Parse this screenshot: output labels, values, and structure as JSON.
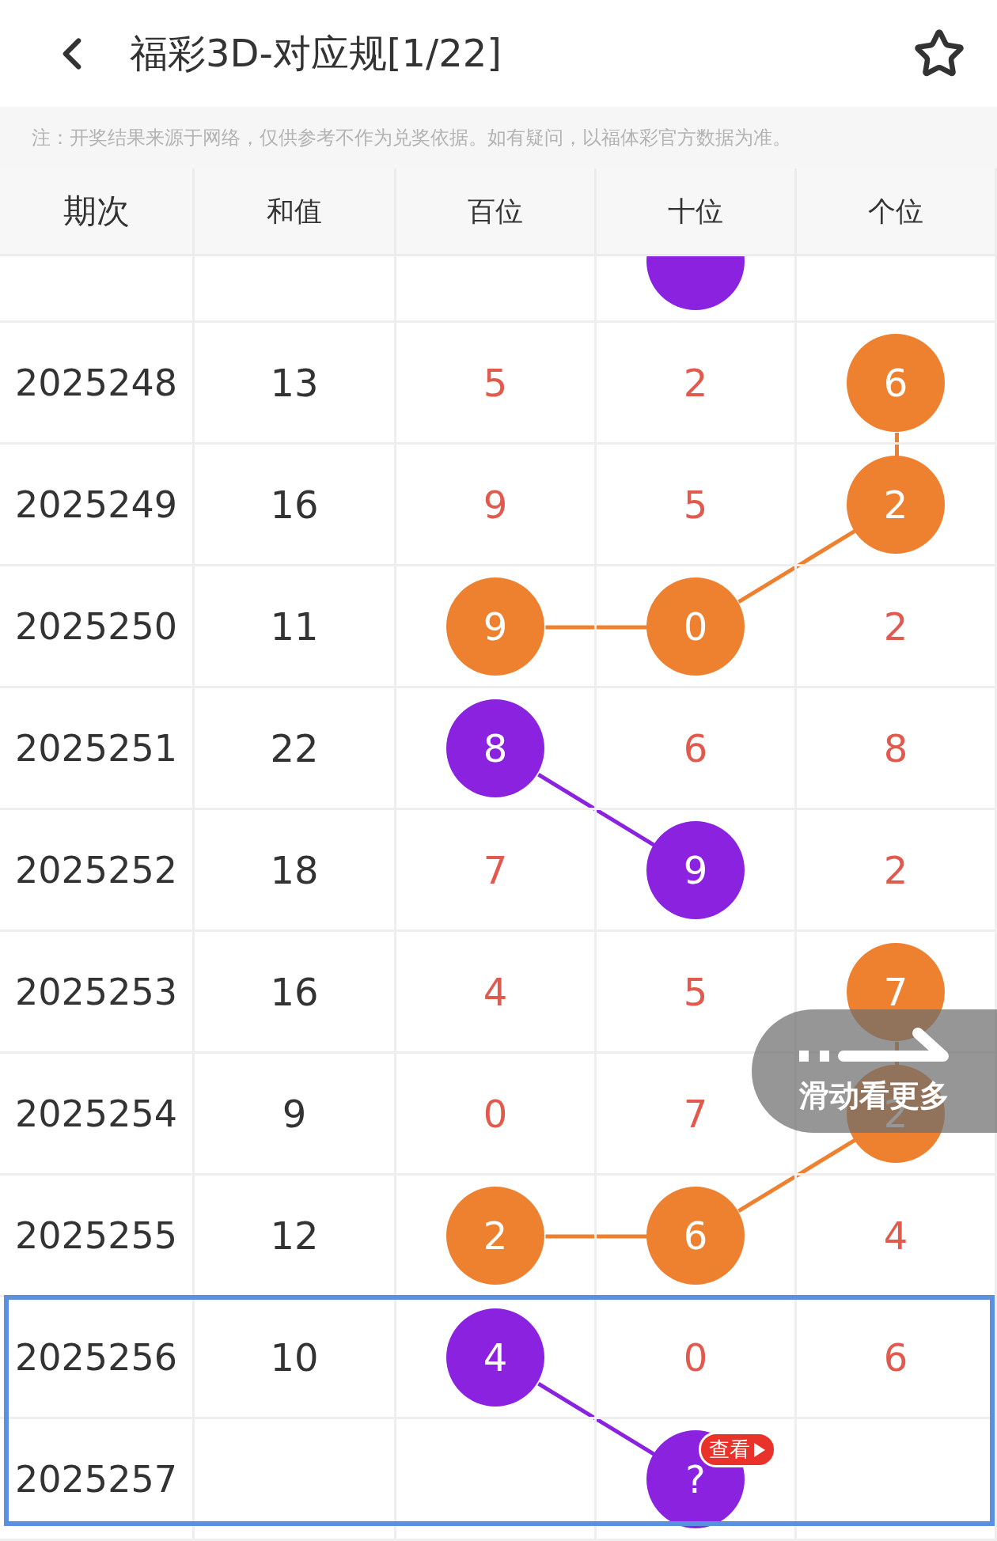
{
  "header": {
    "title": "福彩3D-对应规[1/22]"
  },
  "notice": "注：开奖结果来源于网络，仅供参考不作为兑奖依据。如有疑问，以福体彩官方数据为准。",
  "columns": [
    "期次",
    "和值",
    "百位",
    "十位",
    "个位"
  ],
  "rows": [
    {
      "selected": false,
      "tens": {
        "color": "#8a22e0"
      }
    },
    {
      "issue": "2025248",
      "sum": "13",
      "selected": false,
      "hundreds": {
        "value": "5"
      },
      "tens": {
        "value": "2"
      },
      "units": {
        "value": "6",
        "color": "#ee8130"
      }
    },
    {
      "issue": "2025249",
      "sum": "16",
      "selected": false,
      "hundreds": {
        "value": "9"
      },
      "tens": {
        "value": "5"
      },
      "units": {
        "value": "2",
        "color": "#ee8130"
      }
    },
    {
      "issue": "2025250",
      "sum": "11",
      "selected": false,
      "hundreds": {
        "value": "9",
        "color": "#ee8130"
      },
      "tens": {
        "value": "0",
        "color": "#ee8130"
      },
      "units": {
        "value": "2"
      }
    },
    {
      "issue": "2025251",
      "sum": "22",
      "selected": false,
      "hundreds": {
        "value": "8",
        "color": "#8a22e0"
      },
      "tens": {
        "value": "6"
      },
      "units": {
        "value": "8"
      }
    },
    {
      "issue": "2025252",
      "sum": "18",
      "selected": false,
      "hundreds": {
        "value": "7"
      },
      "tens": {
        "value": "9",
        "color": "#8a22e0"
      },
      "units": {
        "value": "2"
      }
    },
    {
      "issue": "2025253",
      "sum": "16",
      "selected": false,
      "hundreds": {
        "value": "4"
      },
      "tens": {
        "value": "5"
      },
      "units": {
        "value": "7",
        "color": "#ee8130"
      }
    },
    {
      "issue": "2025254",
      "sum": "9",
      "selected": false,
      "hundreds": {
        "value": "0"
      },
      "tens": {
        "value": "7"
      },
      "units": {
        "value": "2",
        "color": "#ee8130"
      }
    },
    {
      "issue": "2025255",
      "sum": "12",
      "selected": false,
      "hundreds": {
        "value": "2",
        "color": "#ee8130"
      },
      "tens": {
        "value": "6",
        "color": "#ee8130"
      },
      "units": {
        "value": "4"
      }
    },
    {
      "issue": "2025256",
      "sum": "10",
      "selected": true,
      "hundreds": {
        "value": "4",
        "color": "#8a22e0"
      },
      "tens": {
        "value": "0"
      },
      "units": {
        "value": "6"
      }
    },
    {
      "issue": "2025257",
      "selected": true,
      "tens": {
        "value": "?",
        "color": "#8a22e0",
        "badge": "查看"
      }
    }
  ],
  "swipe_hint": "滑动看更多"
}
